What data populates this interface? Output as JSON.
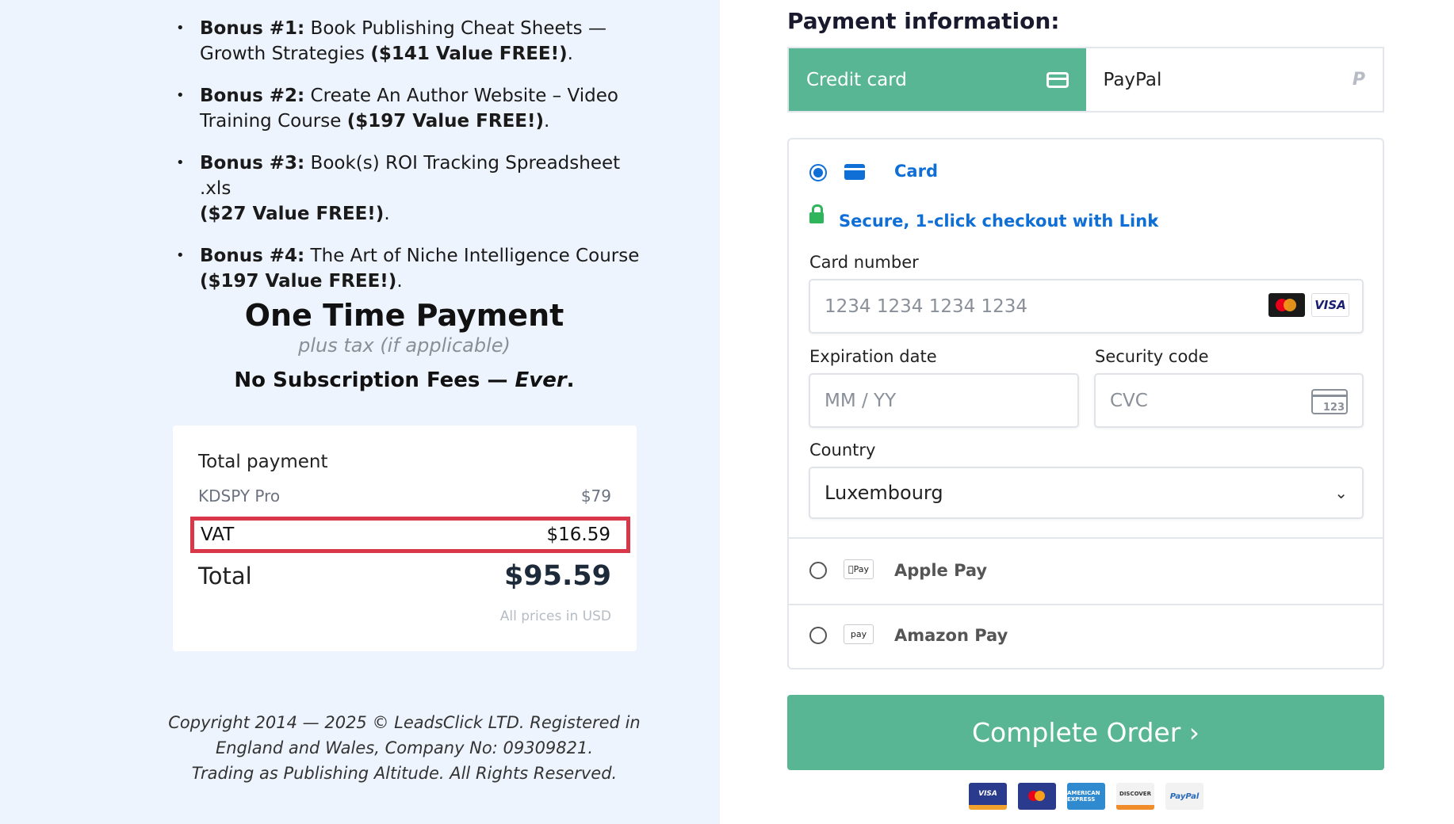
{
  "bonuses": [
    {
      "label": "Bonus #1:",
      "text": " Book Publishing Cheat Sheets — Growth Strategies ",
      "value": "($141 Value FREE!)",
      "end": "."
    },
    {
      "label": "Bonus #2:",
      "text": " Create An Author Website – Video Training Course ",
      "value": "($197 Value FREE!)",
      "end": "."
    },
    {
      "label": "Bonus #3:",
      "text": " Book(s) ROI Tracking Spreadsheet .xls ",
      "value": "($27 Value FREE!)",
      "end": "."
    },
    {
      "label": "Bonus #4:",
      "text": " The Art of Niche Intelligence Course ",
      "value": "($197 Value FREE!)",
      "end": "."
    }
  ],
  "pricing": {
    "title": "One Time Payment",
    "subtitle": "plus tax (if applicable)",
    "no_fees_prefix": "No Subscription Fees — ",
    "no_fees_emph": "Ever",
    "no_fees_end": "."
  },
  "summary": {
    "title": "Total payment",
    "product_name": "KDSPY Pro",
    "product_price": "$79",
    "vat_label": "VAT",
    "vat_value": "$16.59",
    "total_label": "Total",
    "total_value": "$95.59",
    "currency_note": "All prices in USD",
    "highlight_color": "#d9384a"
  },
  "copyright": {
    "line1": "Copyright 2014 — 2025 © LeadsClick LTD. Registered in",
    "line2": "England and Wales, Company No: 09309821.",
    "line3": "Trading as Publishing Altitude. All Rights Reserved."
  },
  "payment": {
    "heading": "Payment information:",
    "tabs": [
      {
        "label": "Credit card",
        "icon": "credit-card-icon",
        "active": true
      },
      {
        "label": "PayPal",
        "icon": "paypal-icon",
        "active": false
      }
    ],
    "card_option_label": "Card",
    "link_text": "Secure, 1-click checkout with Link",
    "card_number_label": "Card number",
    "card_number_placeholder": "1234 1234 1234 1234",
    "visa_text": "VISA",
    "expiry_label": "Expiration date",
    "expiry_placeholder": "MM / YY",
    "cvc_label": "Security code",
    "cvc_placeholder": "CVC",
    "cvc_icon_text": "123",
    "country_label": "Country",
    "country_value": "Luxembourg",
    "alt_methods": [
      {
        "label": "Apple Pay",
        "icon_text": "Pay"
      },
      {
        "label": "Amazon Pay",
        "icon_text": "pay"
      }
    ],
    "complete_button": "Complete Order ›",
    "logos": [
      "VISA",
      "",
      "AMERICAN EXPRESS",
      "DISCOVER",
      "PayPal"
    ],
    "accent_color": "#59b695",
    "link_color": "#0f6fd6"
  }
}
